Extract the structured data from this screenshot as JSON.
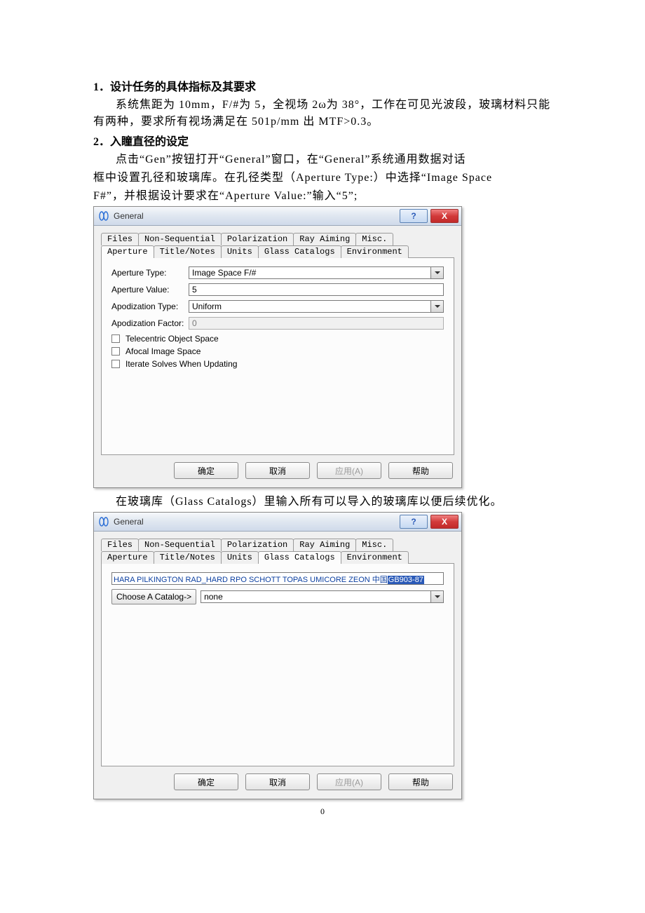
{
  "doc": {
    "section1_title": "1．设计任务的具体指标及其要求",
    "section1_body": "系统焦距为 10mm，F/#为 5，全视场 2ω为 38°，工作在可见光波段，玻璃材料只能有两种，要求所有视场满足在 501p/mm 出 MTF>0.3。",
    "section2_title": "2．入瞳直径的设定",
    "section2_body_a": "点击“Gen”按钮打开“General”窗口，在“General”系统通用数据对话",
    "section2_body_b": "框中设置孔径和玻璃库。在孔径类型（Aperture Type:）中选择“Image Space",
    "section2_body_c": "F#”，并根据设计要求在“Aperture Value:”输入“5”;",
    "mid_text": "在玻璃库（Glass Catalogs）里输入所有可以导入的玻璃库以便后续优化。",
    "page_number": "0"
  },
  "dialog1": {
    "title": "General",
    "tabs_row1": [
      "Files",
      "Non-Sequential",
      "Polarization",
      "Ray Aiming",
      "Misc."
    ],
    "tabs_row2": [
      "Aperture",
      "Title/Notes",
      "Units",
      "Glass Catalogs",
      "Environment"
    ],
    "active_tab": "Aperture",
    "aperture_type_label": "Aperture Type:",
    "aperture_type_value": "Image Space F/#",
    "aperture_value_label": "Aperture Value:",
    "aperture_value_value": "5",
    "apodization_type_label": "Apodization Type:",
    "apodization_type_value": "Uniform",
    "apodization_factor_label": "Apodization Factor:",
    "apodization_factor_value": "0",
    "chk1": "Telecentric Object Space",
    "chk2": "Afocal Image Space",
    "chk3": "Iterate Solves When Updating",
    "btn_ok": "确定",
    "btn_cancel": "取消",
    "btn_apply": "应用(A)",
    "btn_help": "帮助"
  },
  "dialog2": {
    "title": "General",
    "tabs_row1": [
      "Files",
      "Non-Sequential",
      "Polarization",
      "Ray Aiming",
      "Misc."
    ],
    "tabs_row2": [
      "Aperture",
      "Title/Notes",
      "Units",
      "Glass Catalogs",
      "Environment"
    ],
    "active_tab": "Glass Catalogs",
    "catalog_prefix": "HARA PILKINGTON RAD_HARD RPO SCHOTT TOPAS UMICORE ZEON 中国",
    "catalog_sel": "GB903-87",
    "choose_label": "Choose A Catalog->",
    "choose_value": "none",
    "btn_ok": "确定",
    "btn_cancel": "取消",
    "btn_apply": "应用(A)",
    "btn_help": "帮助"
  }
}
